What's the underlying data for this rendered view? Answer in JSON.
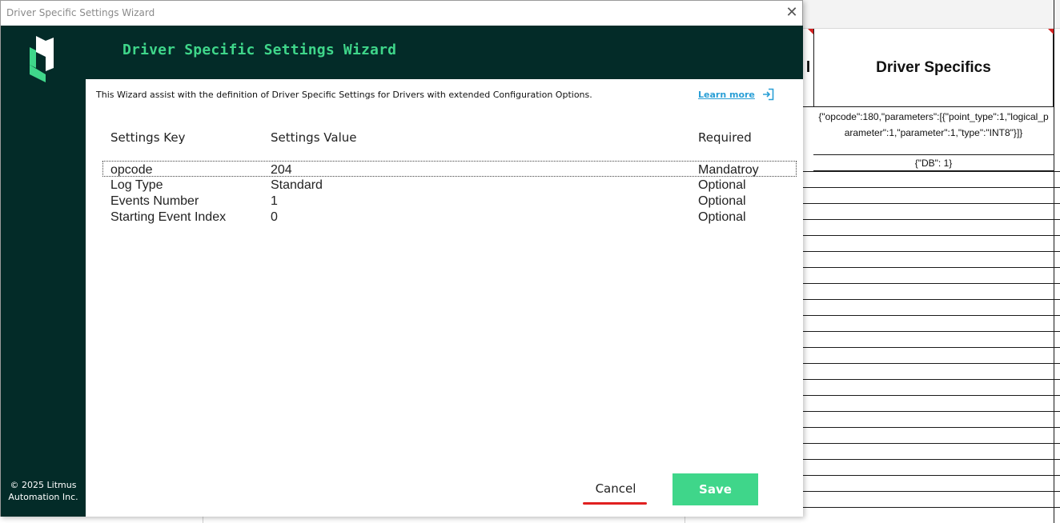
{
  "window": {
    "title": "Driver Specific Settings Wizard",
    "close_glyph": "✕"
  },
  "sidebar": {
    "copyright_line1": "© 2025 Litmus",
    "copyright_line2": "Automation Inc."
  },
  "header": {
    "title": "Driver Specific Settings Wizard"
  },
  "intro": {
    "text": "This Wizard assist with the definition of Driver Specific Settings for Drivers with extended Configuration Options.",
    "learn_more": "Learn more"
  },
  "table": {
    "columns": [
      "Settings Key",
      "Settings Value",
      "Required"
    ],
    "rows": [
      {
        "key": "opcode",
        "value": "204",
        "required": "Mandatroy",
        "selected": true
      },
      {
        "key": "Log Type",
        "value": "Standard",
        "required": "Optional"
      },
      {
        "key": "Events Number",
        "value": "1",
        "required": "Optional"
      },
      {
        "key": "Starting Event Index",
        "value": "0",
        "required": "Optional"
      }
    ]
  },
  "buttons": {
    "cancel": "Cancel",
    "save": "Save"
  },
  "background_sheet": {
    "column_header": "Driver Specifics",
    "prev_column_fragment": "l",
    "cells": [
      "{\"opcode\":180,\"parameters\":[{\"point_type\":1,\"logical_parameter\":1,\"parameter\":1,\"type\":\"INT8\"}]}",
      "{\"DB\": 1}"
    ]
  },
  "colors": {
    "brand_dark": "#032b28",
    "brand_green": "#3fd68a",
    "link_blue": "#2a9fd6",
    "cancel_underline": "#e02020"
  },
  "icons": {
    "logo": "litmus-logo",
    "learn_more": "external-link-icon",
    "close": "close-icon"
  }
}
